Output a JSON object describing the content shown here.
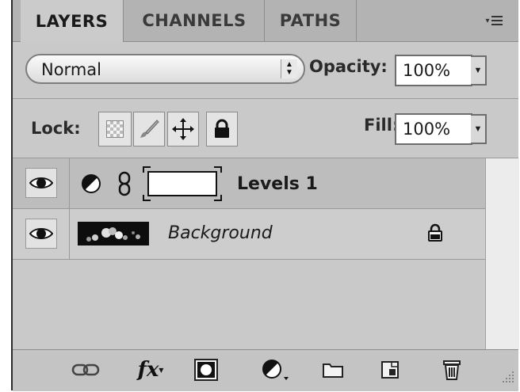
{
  "tabs": [
    {
      "label": "LAYERS",
      "active": true
    },
    {
      "label": "CHANNELS",
      "active": false
    },
    {
      "label": "PATHS",
      "active": false
    }
  ],
  "panel_menu_icon": "panel-menu-icon",
  "blend_mode": {
    "value": "Normal"
  },
  "opacity": {
    "label": "Opacity:",
    "value": "100%"
  },
  "lock": {
    "label": "Lock:",
    "buttons": [
      "lock-transparent-pixels-icon",
      "lock-image-pixels-icon",
      "lock-position-icon",
      "lock-all-icon"
    ]
  },
  "fill": {
    "label": "Fill:",
    "value": "100%"
  },
  "layers": [
    {
      "name": "Levels 1",
      "type": "adjustment",
      "visible": true,
      "selected": true
    },
    {
      "name": "Background",
      "type": "image",
      "visible": true,
      "locked": true
    }
  ],
  "toolbar_icons": [
    "link-layers-icon",
    "layer-style-fx-icon",
    "layer-mask-icon",
    "adjustment-layer-icon",
    "new-group-icon",
    "new-layer-icon",
    "delete-layer-icon"
  ],
  "colors": {
    "panel": "#c9c9c9",
    "tabbar": "#b3b3b3",
    "selected_row": "#bdbdbd"
  }
}
